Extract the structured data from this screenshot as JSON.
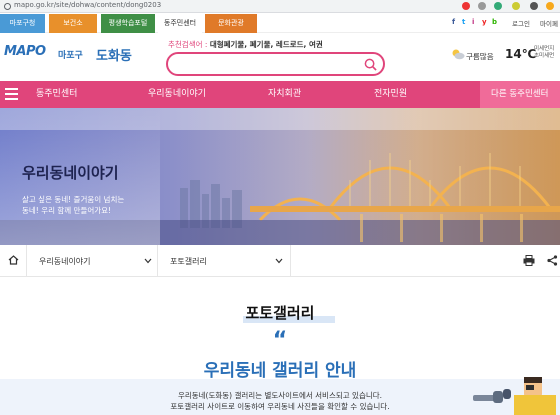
{
  "browser": {
    "url": "mapo.go.kr/site/dohwa/content/dong0203"
  },
  "top_tabs": [
    {
      "label": "마포구청",
      "color": "#4a9ad6"
    },
    {
      "label": "보건소",
      "color": "#e8902b"
    },
    {
      "label": "평생학습포털",
      "color": "#3f8f46"
    },
    {
      "label": "동주민센터",
      "color": "#ffffff"
    },
    {
      "label": "문화관광",
      "color": "#e07a29"
    }
  ],
  "top_links": {
    "social": [
      "f",
      "t",
      "i",
      "y",
      "b"
    ],
    "login": "로그인",
    "mypage": "마이페"
  },
  "header": {
    "logo": "MAPO",
    "logo_gu": "마포구",
    "dong_name": "도화동",
    "rec_label": "추천검색어 :",
    "rec_terms": "대형폐기물, 폐기물, 레드로드, 여권",
    "search_placeholder": ""
  },
  "weather": {
    "condition": "구름많음",
    "temperature": "14℃",
    "dust_line1": "미세먼지",
    "dust_line2": "초미세먼"
  },
  "nav": {
    "items": [
      "동주민센터",
      "우리동네이야기",
      "자치회관",
      "전자민원"
    ],
    "other_dong": "다른 동주민센터"
  },
  "banner": {
    "title": "우리동네이야기",
    "sub_line1": "살고 싶은 동네! 즐거움이 넘치는",
    "sub_line2": "동네! 우리 함께 만들어가요!"
  },
  "breadcrumb": {
    "level1": "우리동네이야기",
    "level2": "포토갤러리"
  },
  "content": {
    "page_title": "포토갤러리",
    "quote_mark": "“",
    "headline": "우리동네 갤러리 안내",
    "desc_line1": "우리동네(도화동) 갤러리는 별도사이트에서 서비스되고 있습니다.",
    "desc_line2": "포토갤러리 사이트로 이동하여 우리동네 사진들을 확인할 수 있습니다."
  },
  "colors": {
    "accent": "#e0457b",
    "brand_blue": "#2a6fb7"
  }
}
